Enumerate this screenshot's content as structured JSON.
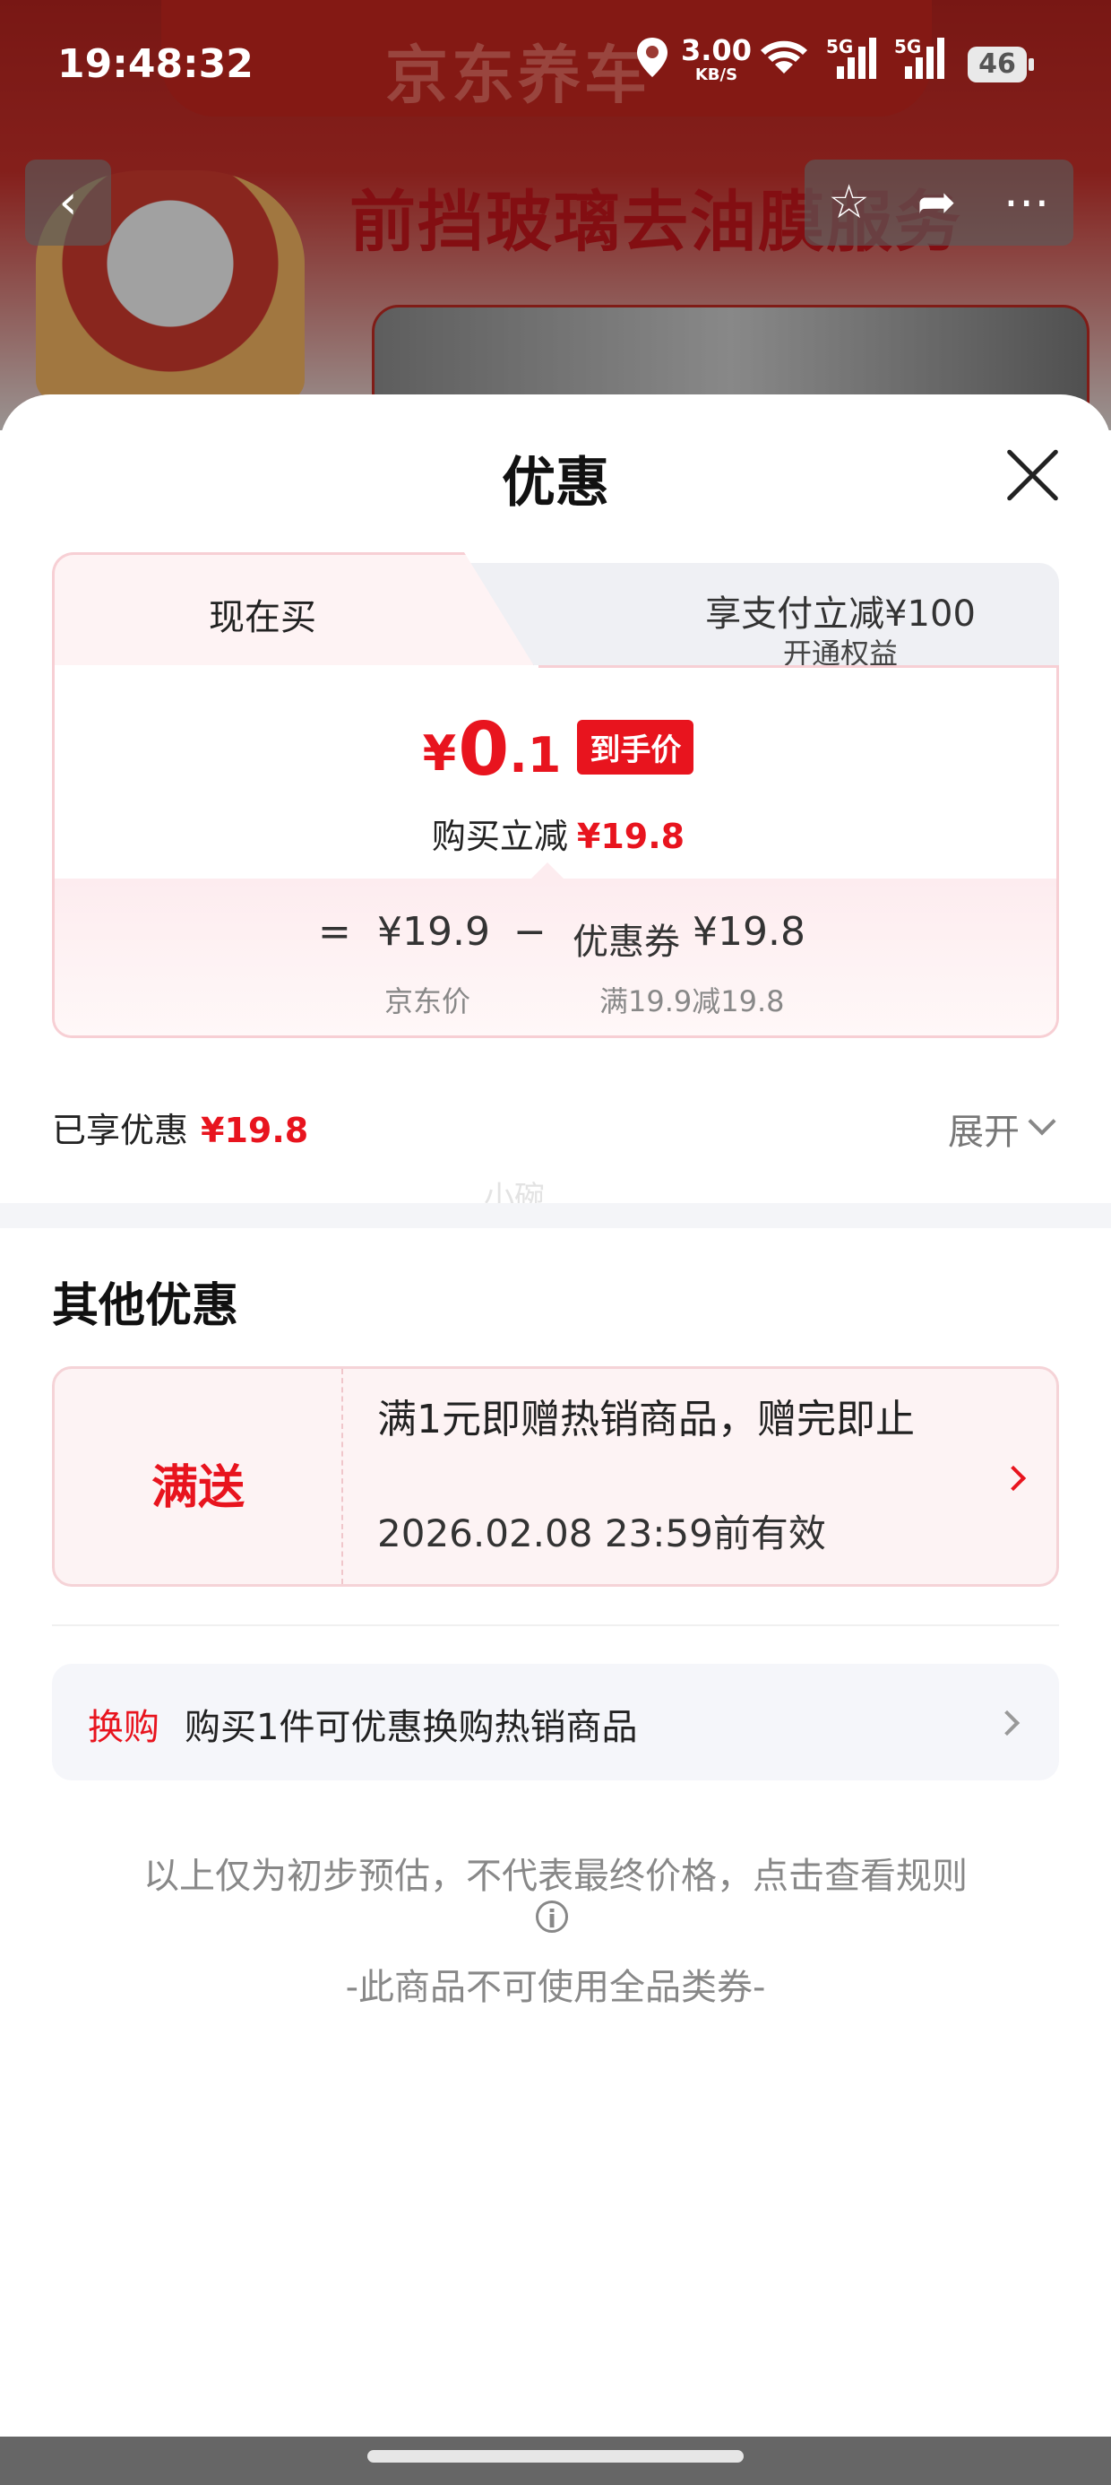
{
  "status_bar": {
    "time": "19:48:32",
    "net_speed": "3.00",
    "net_unit": "KB/S",
    "signal_1": "5G",
    "signal_2": "5G",
    "battery": "46"
  },
  "background_page": {
    "brand": "京东养车",
    "headline": "前挡玻璃去油膜服务"
  },
  "sheet": {
    "title": "优惠",
    "tabs": {
      "now_buy": "现在买",
      "pay_discount": "享支付立减¥100",
      "pay_discount_sub": "开通权益"
    },
    "hand_price": {
      "currency": "¥",
      "integer": "0",
      "decimal": ".1",
      "tag": "到手价"
    },
    "instant_reduction": {
      "label": "购买立减",
      "amount": "¥19.8"
    },
    "calculation": {
      "equals": "=",
      "jd_price": "¥19.9",
      "jd_price_label": "京东价",
      "minus": "−",
      "coupon_label_inline": "优惠券",
      "coupon_amount": "¥19.8",
      "coupon_rule": "满19.9减19.8"
    },
    "enjoyed": {
      "label": "已享优惠",
      "amount": "¥19.8",
      "expand": "展开"
    },
    "watermark": "小碗",
    "other_title": "其他优惠",
    "gift": {
      "tag": "满送",
      "description": "满1元即赠热销商品，赠完即止",
      "validity": "2026.02.08 23:59前有效"
    },
    "swap": {
      "tag": "换购",
      "description": "购买1件可优惠换购热销商品"
    },
    "notice": "以上仅为初步预估，不代表最终价格，点击查看规则",
    "not_usable": "-此商品不可使用全品类券-"
  },
  "colors": {
    "accent_red": "#e8141e",
    "card_pink": "#fdf3f4",
    "gray_bg": "#f5f6fa"
  }
}
